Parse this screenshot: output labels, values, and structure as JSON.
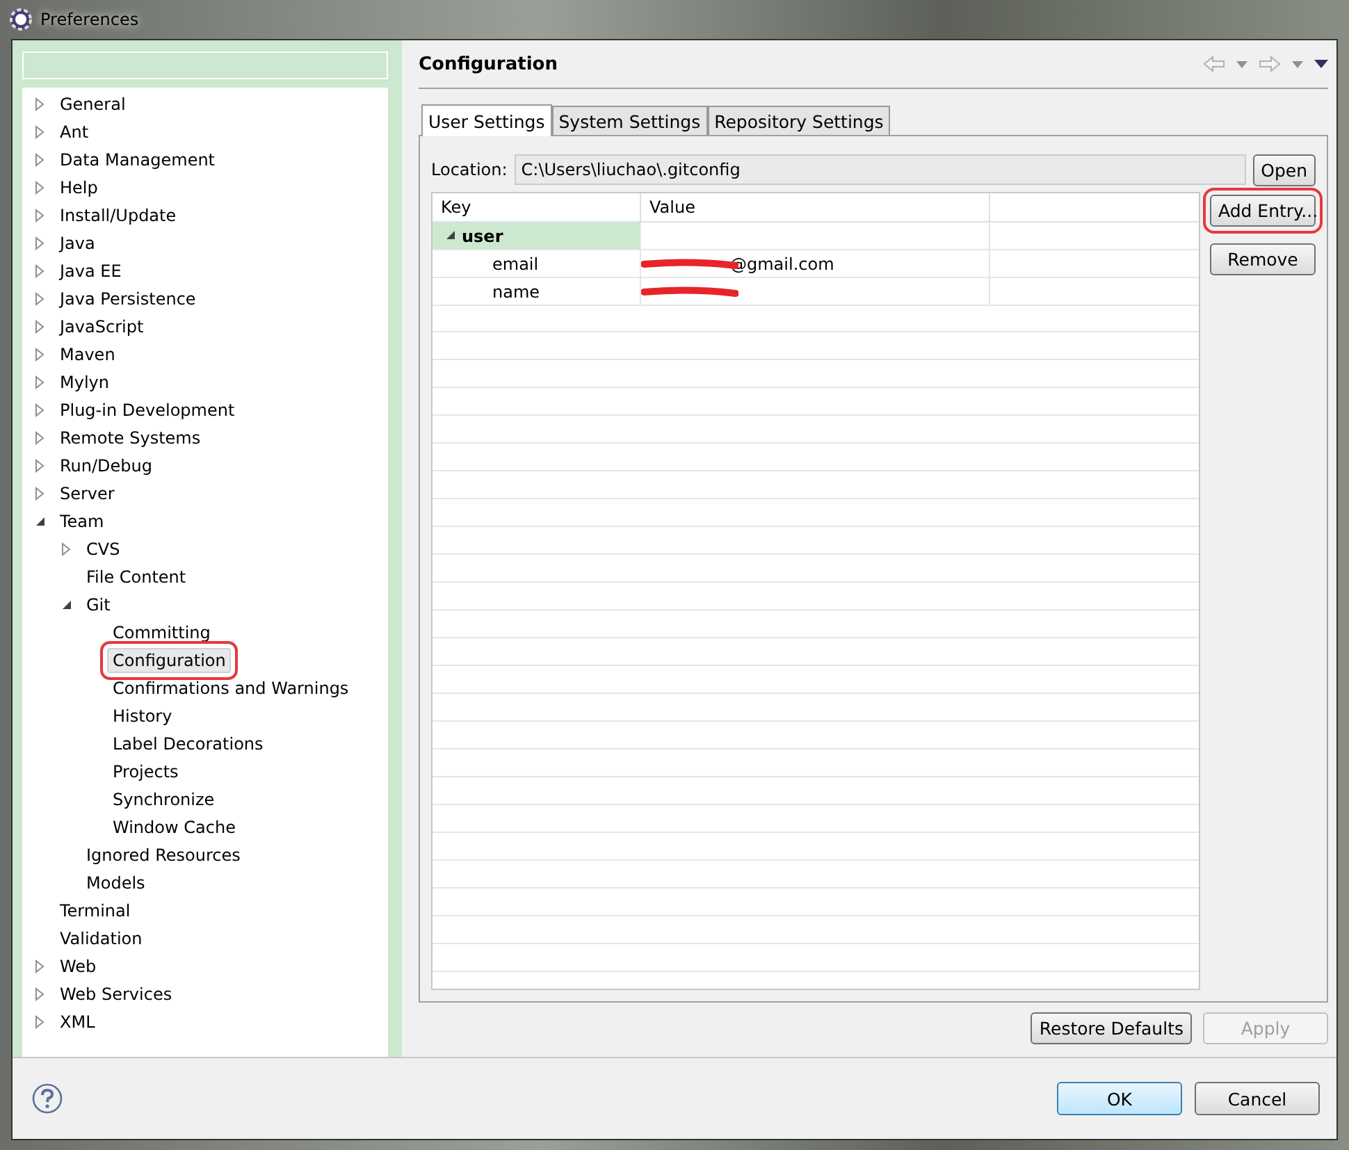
{
  "window": {
    "title": "Preferences"
  },
  "tree": [
    {
      "label": "General",
      "expanded": false,
      "selected": false
    },
    {
      "label": "Ant",
      "expanded": false,
      "selected": false
    },
    {
      "label": "Data Management",
      "expanded": false,
      "selected": false
    },
    {
      "label": "Help",
      "expanded": false,
      "selected": false
    },
    {
      "label": "Install/Update",
      "expanded": false,
      "selected": false
    },
    {
      "label": "Java",
      "expanded": false,
      "selected": false
    },
    {
      "label": "Java EE",
      "expanded": false,
      "selected": false
    },
    {
      "label": "Java Persistence",
      "expanded": false,
      "selected": false
    },
    {
      "label": "JavaScript",
      "expanded": false,
      "selected": false
    },
    {
      "label": "Maven",
      "expanded": false,
      "selected": false
    },
    {
      "label": "Mylyn",
      "expanded": false,
      "selected": false
    },
    {
      "label": "Plug-in Development",
      "expanded": false,
      "selected": false
    },
    {
      "label": "Remote Systems",
      "expanded": false,
      "selected": false
    },
    {
      "label": "Run/Debug",
      "expanded": false,
      "selected": false
    },
    {
      "label": "Server",
      "expanded": false,
      "selected": false
    },
    {
      "label": "Team",
      "expanded": true,
      "selected": false,
      "children": [
        {
          "label": "CVS",
          "expanded": false,
          "selected": false
        },
        {
          "label": "File Content",
          "selected": false
        },
        {
          "label": "Git",
          "expanded": true,
          "selected": false,
          "children": [
            {
              "label": "Committing",
              "selected": false
            },
            {
              "label": "Configuration",
              "selected": true,
              "annotated": true
            },
            {
              "label": "Confirmations and Warnings",
              "selected": false
            },
            {
              "label": "History",
              "selected": false
            },
            {
              "label": "Label Decorations",
              "selected": false
            },
            {
              "label": "Projects",
              "selected": false
            },
            {
              "label": "Synchronize",
              "selected": false
            },
            {
              "label": "Window Cache",
              "selected": false
            }
          ]
        },
        {
          "label": "Ignored Resources",
          "selected": false
        },
        {
          "label": "Models",
          "selected": false
        }
      ]
    },
    {
      "label": "Terminal",
      "selected": false
    },
    {
      "label": "Validation",
      "selected": false
    },
    {
      "label": "Web",
      "expanded": false,
      "selected": false
    },
    {
      "label": "Web Services",
      "expanded": false,
      "selected": false
    },
    {
      "label": "XML",
      "expanded": false,
      "selected": false
    }
  ],
  "page": {
    "title": "Configuration"
  },
  "tabs": [
    {
      "label": "User Settings",
      "selected": true
    },
    {
      "label": "System Settings",
      "selected": false
    },
    {
      "label": "Repository Settings",
      "selected": false
    }
  ],
  "location": {
    "label": "Location:",
    "value": "C:\\Users\\liuchao\\.gitconfig",
    "button": "Open"
  },
  "table": {
    "columns": [
      "Key",
      "Value"
    ],
    "rows": [
      {
        "key": "user",
        "kind": "section",
        "expanded": true,
        "redacted": false
      },
      {
        "key": "email",
        "value": "@gmail.com",
        "kind": "entry",
        "redacted": true
      },
      {
        "key": "name",
        "kind": "entry",
        "redacted": true
      }
    ]
  },
  "side_buttons": [
    {
      "label": "Add Entry...",
      "annotated": true
    },
    {
      "label": "Remove",
      "annotated": false
    }
  ],
  "page_buttons": [
    {
      "label": "Restore Defaults",
      "disabled": false
    },
    {
      "label": "Apply",
      "disabled": true
    }
  ],
  "dialog_buttons": [
    {
      "label": "OK",
      "default": true
    },
    {
      "label": "Cancel",
      "default": false
    }
  ]
}
